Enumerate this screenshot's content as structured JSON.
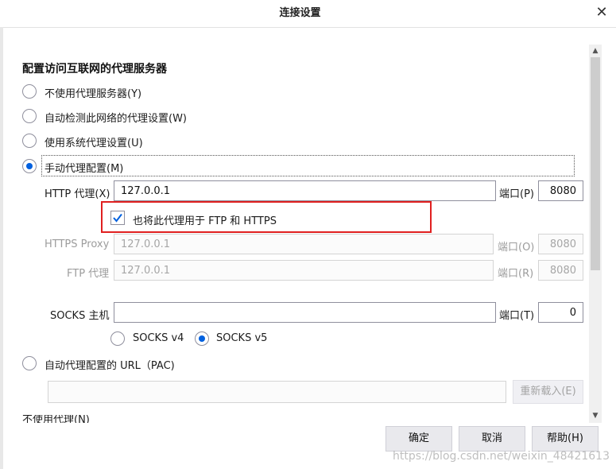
{
  "window": {
    "title": "连接设置",
    "close_label": "✕"
  },
  "section_title": "配置访问互联网的代理服务器",
  "options": {
    "no_proxy": "不使用代理服务器(Y)",
    "auto_detect": "自动检测此网络的代理设置(W)",
    "system": "使用系统代理设置(U)",
    "manual": "手动代理配置(M)",
    "pac": "自动代理配置的 URL（PAC)"
  },
  "http": {
    "label": "HTTP 代理(X)",
    "value": "127.0.0.1",
    "port_label": "端口(P)",
    "port": "8080"
  },
  "also_use": {
    "label": "也将此代理用于 FTP 和 HTTPS",
    "checked": true
  },
  "https": {
    "label": "HTTPS Proxy",
    "value": "127.0.0.1",
    "port_label": "端口(O)",
    "port": "8080"
  },
  "ftp": {
    "label": "FTP 代理",
    "value": "127.0.0.1",
    "port_label": "端口(R)",
    "port": "8080"
  },
  "socks": {
    "label": "SOCKS 主机",
    "value": "",
    "port_label": "端口(T)",
    "port": "0",
    "v4": "SOCKS v4",
    "v5": "SOCKS v5"
  },
  "pac_url": {
    "value": "",
    "reload_label": "重新载入(E)"
  },
  "cut_text": "不使用代理(N)",
  "buttons": {
    "ok": "确定",
    "cancel": "取消",
    "help": "帮助(H)"
  },
  "watermark": "https://blog.csdn.net/weixin_48421613",
  "colors": {
    "accent": "#0060df",
    "highlight": "#e02020"
  }
}
